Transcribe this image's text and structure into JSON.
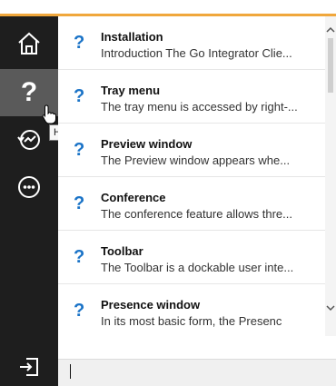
{
  "nav": {
    "home_icon": "home-icon",
    "help_icon": "help-icon",
    "history_icon": "history-icon",
    "more_icon": "more-icon",
    "logout_icon": "logout-icon",
    "help_glyph": "?",
    "tooltip": "Help"
  },
  "topics": [
    {
      "icon": "?",
      "title": "Installation",
      "summary": "Introduction The Go Integrator Clie..."
    },
    {
      "icon": "?",
      "title": "Tray menu",
      "summary": "The tray menu is accessed by right-..."
    },
    {
      "icon": "?",
      "title": "Preview window",
      "summary": "The Preview window appears whe..."
    },
    {
      "icon": "?",
      "title": "Conference",
      "summary": "The conference feature allows thre..."
    },
    {
      "icon": "?",
      "title": "Toolbar",
      "summary": "The Toolbar is a dockable user inte..."
    },
    {
      "icon": "?",
      "title": "Presence window",
      "summary": "In its most basic form, the Presenc"
    }
  ],
  "search": {
    "value": ""
  },
  "colors": {
    "accent": "#f0a73c",
    "rail": "#1e1e1e",
    "rail_active": "#5a5a5a",
    "help_blue": "#1a73c7"
  }
}
